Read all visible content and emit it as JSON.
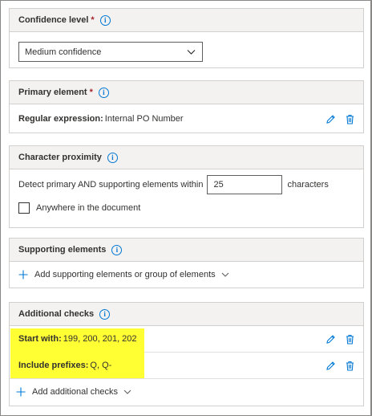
{
  "colors": {
    "accent": "#0078d4",
    "required": "#a4262c",
    "highlight": "#ffff33"
  },
  "confidence": {
    "title": "Confidence level",
    "required_mark": "*",
    "info_icon": "i",
    "selected": "Medium confidence"
  },
  "primary": {
    "title": "Primary element",
    "required_mark": "*",
    "info_icon": "i",
    "label": "Regular expression:",
    "value": "Internal PO Number"
  },
  "proximity": {
    "title": "Character proximity",
    "info_icon": "i",
    "prefix_text": "Detect primary AND supporting elements within",
    "value": "25",
    "suffix_text": "characters",
    "anywhere_label": "Anywhere in the document"
  },
  "supporting": {
    "title": "Supporting elements",
    "info_icon": "i",
    "add_label": "Add supporting elements or group of elements"
  },
  "additional": {
    "title": "Additional checks",
    "info_icon": "i",
    "checks": [
      {
        "label": "Start with:",
        "value": "199, 200, 201, 202"
      },
      {
        "label": "Include prefixes:",
        "value": "Q, Q-"
      }
    ],
    "add_label": "Add additional checks"
  }
}
